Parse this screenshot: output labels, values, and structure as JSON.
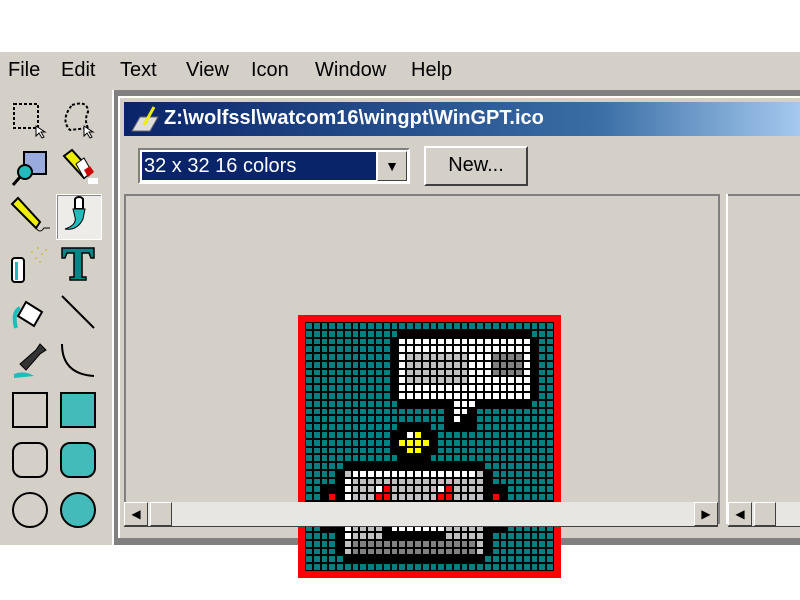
{
  "menu": {
    "items": [
      "File",
      "Edit",
      "Text",
      "View",
      "Icon",
      "Window",
      "Help"
    ]
  },
  "toolbox": {
    "tools": [
      {
        "name": "rect-select"
      },
      {
        "name": "lasso-select"
      },
      {
        "name": "zoom"
      },
      {
        "name": "eraser"
      },
      {
        "name": "pencil"
      },
      {
        "name": "brush",
        "selected": true
      },
      {
        "name": "airbrush"
      },
      {
        "name": "text"
      },
      {
        "name": "fill"
      },
      {
        "name": "line"
      },
      {
        "name": "dropper"
      },
      {
        "name": "curve"
      },
      {
        "name": "rectangle"
      },
      {
        "name": "filled-rectangle"
      },
      {
        "name": "rounded-rectangle"
      },
      {
        "name": "filled-rounded-rectangle"
      },
      {
        "name": "ellipse"
      },
      {
        "name": "filled-ellipse"
      }
    ]
  },
  "window": {
    "title": "Z:\\wolfssl\\watcom16\\wingpt\\WinGPT.ico",
    "format_select": "32 x 32  16 colors",
    "new_button": "New..."
  },
  "colors": {
    "accent": "#0a246a",
    "teal": "#008080",
    "frame": "#ff0000",
    "face": "#d4d0c8"
  }
}
